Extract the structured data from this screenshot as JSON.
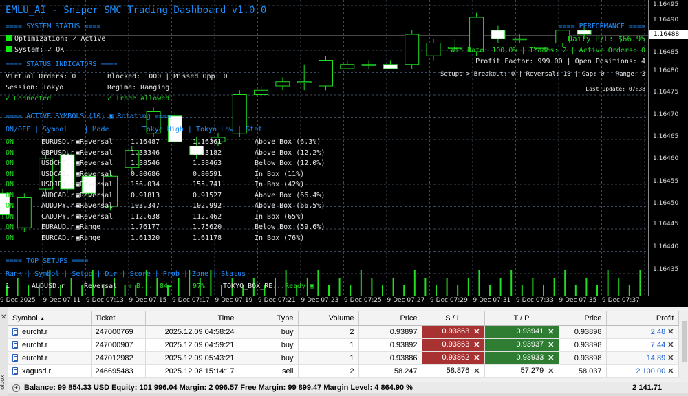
{
  "chart": {
    "title": "EMLU_AI - Sniper SMC Trading Dashboard v1.0.0",
    "price_labels": [
      "1.16495",
      "1.16490",
      "1.16488",
      "1.16485",
      "1.16480",
      "1.16475",
      "1.16470",
      "1.16465",
      "1.16460",
      "1.16455",
      "1.16450",
      "1.16445",
      "1.16440",
      "1.16435"
    ],
    "current_price": "1.16488",
    "time_labels": [
      "9 Dec 2025",
      "9 Dec 07:11",
      "9 Dec 07:13",
      "9 Dec 07:15",
      "9 Dec 07:17",
      "9 Dec 07:19",
      "9 Dec 07:21",
      "9 Dec 07:23",
      "9 Dec 07:25",
      "9 Dec 07:27",
      "9 Dec 07:29",
      "9 Dec 07:31",
      "9 Dec 07:33",
      "9 Dec 07:35",
      "9 Dec 07:37"
    ],
    "candles": [
      {
        "o": 1.16452,
        "c": 1.16447,
        "h": 1.16453,
        "l": 1.16446
      },
      {
        "o": 1.16444,
        "c": 1.16451,
        "h": 1.16452,
        "l": 1.16443
      },
      {
        "o": 1.16453,
        "c": 1.1646,
        "h": 1.16461,
        "l": 1.16452
      },
      {
        "o": 1.16461,
        "c": 1.16453,
        "h": 1.16462,
        "l": 1.16452
      },
      {
        "o": 1.16456,
        "c": 1.16452,
        "h": 1.16457,
        "l": 1.16451
      },
      {
        "o": 1.16449,
        "c": 1.16456,
        "h": 1.16457,
        "l": 1.16448
      },
      {
        "o": 1.16458,
        "c": 1.16462,
        "h": 1.16463,
        "l": 1.16457
      },
      {
        "o": 1.16466,
        "c": 1.16471,
        "h": 1.16472,
        "l": 1.16465
      },
      {
        "o": 1.1647,
        "c": 1.16464,
        "h": 1.16471,
        "l": 1.16463
      },
      {
        "o": 1.16463,
        "c": 1.16461,
        "h": 1.16465,
        "l": 1.1646
      },
      {
        "o": 1.16464,
        "c": 1.16465,
        "h": 1.16466,
        "l": 1.16463
      },
      {
        "o": 1.16466,
        "c": 1.16475,
        "h": 1.16476,
        "l": 1.16465
      },
      {
        "o": 1.16475,
        "c": 1.16476,
        "h": 1.16477,
        "l": 1.16474
      },
      {
        "o": 1.16477,
        "c": 1.16478,
        "h": 1.16479,
        "l": 1.16476
      },
      {
        "o": 1.16478,
        "c": 1.16478,
        "h": 1.16482,
        "l": 1.16476
      },
      {
        "o": 1.16477,
        "c": 1.16483,
        "h": 1.16484,
        "l": 1.16476
      },
      {
        "o": 1.16481,
        "c": 1.16482,
        "h": 1.16483,
        "l": 1.16481
      },
      {
        "o": 1.16482,
        "c": 1.16482,
        "h": 1.16483,
        "l": 1.16481
      },
      {
        "o": 1.16482,
        "c": 1.16481,
        "h": 1.16483,
        "l": 1.16481
      },
      {
        "o": 1.16482,
        "c": 1.16489,
        "h": 1.1649,
        "l": 1.16481
      },
      {
        "o": 1.16484,
        "c": 1.16487,
        "h": 1.16488,
        "l": 1.16483
      },
      {
        "o": 1.16486,
        "c": 1.16486,
        "h": 1.16488,
        "l": 1.16485
      },
      {
        "o": 1.16485,
        "c": 1.16493,
        "h": 1.16494,
        "l": 1.16484
      },
      {
        "o": 1.1649,
        "c": 1.16488,
        "h": 1.16491,
        "l": 1.16487
      },
      {
        "o": 1.16488,
        "c": 1.16488,
        "h": 1.16489,
        "l": 1.16487
      },
      {
        "o": 1.16486,
        "c": 1.16486,
        "h": 1.16487,
        "l": 1.16486
      },
      {
        "o": 1.16487,
        "c": 1.1649,
        "h": 1.1649,
        "l": 1.16486
      },
      {
        "o": 1.1649,
        "c": 1.16489,
        "h": 1.16491,
        "l": 1.16488
      }
    ],
    "volumes": [
      1,
      2,
      1,
      1,
      3,
      1,
      2,
      1,
      3,
      1,
      2,
      1,
      1,
      3,
      2,
      1,
      2,
      3,
      2,
      3,
      1,
      2,
      1,
      2,
      1,
      2,
      3,
      1,
      2,
      3,
      1,
      2,
      1,
      3,
      2,
      1,
      2,
      1,
      3,
      2,
      1,
      2,
      1,
      2,
      3,
      1,
      2,
      3,
      1,
      2,
      1,
      2,
      3,
      1,
      2,
      1,
      3,
      2,
      1,
      3
    ]
  },
  "status": {
    "system_header": "==== SYSTEM STATUS ====",
    "optimization": "Optimization: ✓ Active",
    "system": "System: ✓ OK",
    "indicators_header": "==== STATUS INDICATORS ====",
    "virtual_orders": "Virtual Orders: 0",
    "blocked": "Blocked: 1000 | Missed Opp: 0",
    "session": "Session: Tokyo",
    "regime": "Regime: Ranging",
    "connected": "✓ Connected",
    "trade_allowed": "✓ Trade Allowed"
  },
  "performance": {
    "header": "==== PERFORMANCE ====",
    "daily_pl": "Daily P/L: $66.95",
    "line2": "Win Rate: 100.0% | Trades: 2 | Active Orders: 0",
    "line3": "Profit Factor: 999.00 | Open Positions: 4",
    "line4": "Setups > Breakout: 0 | Reversal: 13 | Gap: 0 | Range: 3",
    "last_update": "Last Update: 07:38"
  },
  "symbols": {
    "header": "==== ACTIVE SYMBOLS (10) ▣ Rotating ====",
    "columns": "ON/OFF | Symbol    | Mode      | Tokyo High | Tokyo Low | Stat",
    "rows": [
      {
        "on": "ON",
        "symbol": "EURUSD.r",
        "mode": "▣Reversal",
        "high": "1.16487",
        "low": "1.16361",
        "stat": "Above Box (6.3%)"
      },
      {
        "on": "ON",
        "symbol": "GBPUSD.r",
        "mode": "▣Reversal",
        "high": "1.33346",
        "low": "1.33182",
        "stat": "Above Box (12.2%)"
      },
      {
        "on": "ON",
        "symbol": "USDCHF.r",
        "mode": "▣Reversal",
        "high": "1.38546",
        "low": "1.38463",
        "stat": "Below Box (12.0%)"
      },
      {
        "on": "ON",
        "symbol": "USDCAD.r",
        "mode": "▣Reversal",
        "high": "0.80686",
        "low": "0.80591",
        "stat": "In Box (11%)"
      },
      {
        "on": "ON",
        "symbol": "USDJPY.r",
        "mode": "▣Reversal",
        "high": "156.034",
        "low": "155.741",
        "stat": "In Box (42%)"
      },
      {
        "on": "ON",
        "symbol": "AUDCAD.r",
        "mode": "▣Reversal",
        "high": "0.91813",
        "low": "0.91527",
        "stat": "Above Box (66.4%)"
      },
      {
        "on": "ON",
        "symbol": "AUDJPY.r",
        "mode": "▣Reversal",
        "high": "103.347",
        "low": "102.992",
        "stat": "Above Box (66.5%)"
      },
      {
        "on": "ON",
        "symbol": "CADJPY.r",
        "mode": "▣Reversal",
        "high": "112.638",
        "low": "112.462",
        "stat": "In Box (65%)"
      },
      {
        "on": "ON",
        "symbol": "EURAUD.r",
        "mode": "▣Range",
        "high": "1.76177",
        "low": "1.75620",
        "stat": "Below Box (59.6%)"
      },
      {
        "on": "ON",
        "symbol": "EURCAD.r",
        "mode": "▣Range",
        "high": "1.61320",
        "low": "1.61178",
        "stat": "In Box (76%)"
      }
    ]
  },
  "setups": {
    "header": "==== TOP SETUPS ====",
    "columns": "Rank | Symbol | Setup | Dir | Score | Prob | Zone | Status",
    "row": {
      "rank": "1",
      "symbol": "AUDUSD.r",
      "setup": "Reversal",
      "dir": "↑ B...",
      "score": "84★",
      "prob": "97%",
      "zone": "TOKYO_BOX_RE...",
      "status": "Ready ▣"
    }
  },
  "terminal": {
    "side_label": "olbox",
    "columns": [
      "Symbol",
      "Ticket",
      "Time",
      "Type",
      "Volume",
      "Price",
      "S / L",
      "T / P",
      "Price",
      "Profit"
    ],
    "rows": [
      {
        "symbol": "eurchf.r",
        "ticket": "247000769",
        "time": "2025.12.09 04:58:24",
        "type": "buy",
        "volume": "2",
        "price": "0.93897",
        "sl": "0.93863",
        "tp": "0.93941",
        "cur": "0.93898",
        "profit": "2.48"
      },
      {
        "symbol": "eurchf.r",
        "ticket": "247000907",
        "time": "2025.12.09 04:59:21",
        "type": "buy",
        "volume": "1",
        "price": "0.93892",
        "sl": "0.93863",
        "tp": "0.93937",
        "cur": "0.93898",
        "profit": "7.44"
      },
      {
        "symbol": "eurchf.r",
        "ticket": "247012982",
        "time": "2025.12.09 05:43:21",
        "type": "buy",
        "volume": "1",
        "price": "0.93886",
        "sl": "0.93862",
        "tp": "0.93933",
        "cur": "0.93898",
        "profit": "14.89"
      },
      {
        "symbol": "xagusd.r",
        "ticket": "246695483",
        "time": "2025.12.08 15:14:17",
        "type": "sell",
        "volume": "2",
        "price": "58.247",
        "sl": "58.876",
        "tp": "57.279",
        "cur": "58.037",
        "profit": "2 100.00"
      }
    ],
    "summary": "Balance: 99 854.33 USD  Equity: 101 996.04  Margin: 2 096.57  Free Margin: 99 899.47  Margin Level: 4 864.90 %",
    "total_profit": "2 141.71"
  }
}
